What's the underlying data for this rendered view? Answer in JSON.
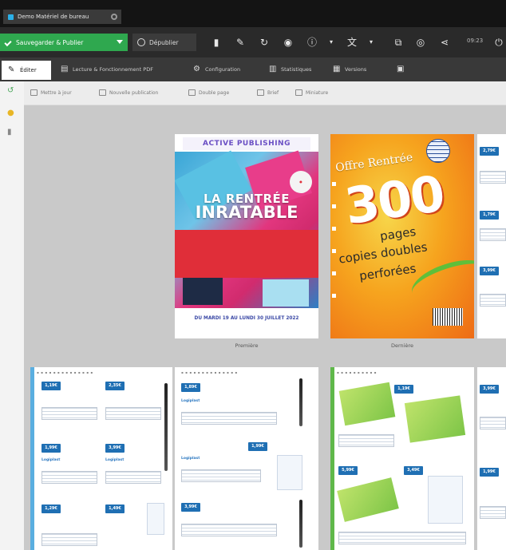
{
  "window": {
    "tab_title": "Demo Matériel de bureau"
  },
  "toolbar": {
    "save_label": "Sauvegarder & Publier",
    "unpublish_label": "Dépublier",
    "time_label": "09:23"
  },
  "subtabs": [
    {
      "label": "Éditer"
    },
    {
      "label": "Lecture & Fonctionnement PDF"
    },
    {
      "label": "Configuration"
    },
    {
      "label": "Statistiques"
    },
    {
      "label": "Versions"
    }
  ],
  "actions": [
    {
      "label": "Mettre à jour"
    },
    {
      "label": "Nouvelle publication"
    },
    {
      "label": "Double page"
    },
    {
      "label": "Brief"
    },
    {
      "label": "Miniature"
    }
  ],
  "pages": {
    "front_caption": "Première",
    "back_caption": "Dernière",
    "front_brand": "ACTIVE PUBLISHING",
    "front_line1": "LA RENTRÉE",
    "front_line2": "INRATABLE",
    "front_dates": "DU MARDI 19 AU LUNDI 30 JUILLET 2022",
    "back_offer": "Offre Rentrée",
    "back_number": "300",
    "back_line1": "pages",
    "back_line2": "copies doubles",
    "back_line3": "perforées",
    "prices": [
      "1,19€",
      "2,35€",
      "1,89€",
      "1,99€",
      "3,99€",
      "1,29€",
      "1,49€",
      "1,99€",
      "3,99€",
      "1,19€",
      "5,99€",
      "3,49€",
      "3,99€",
      "1,79€",
      "3,99€",
      "2,79€"
    ],
    "brand_logo": "Logiplast"
  },
  "colors": {
    "save_green": "#2fa84f",
    "toolbar_dark": "#2a2a2a",
    "canvas_grey": "#c9c9c9",
    "price_blue": "#1f6fb3"
  }
}
